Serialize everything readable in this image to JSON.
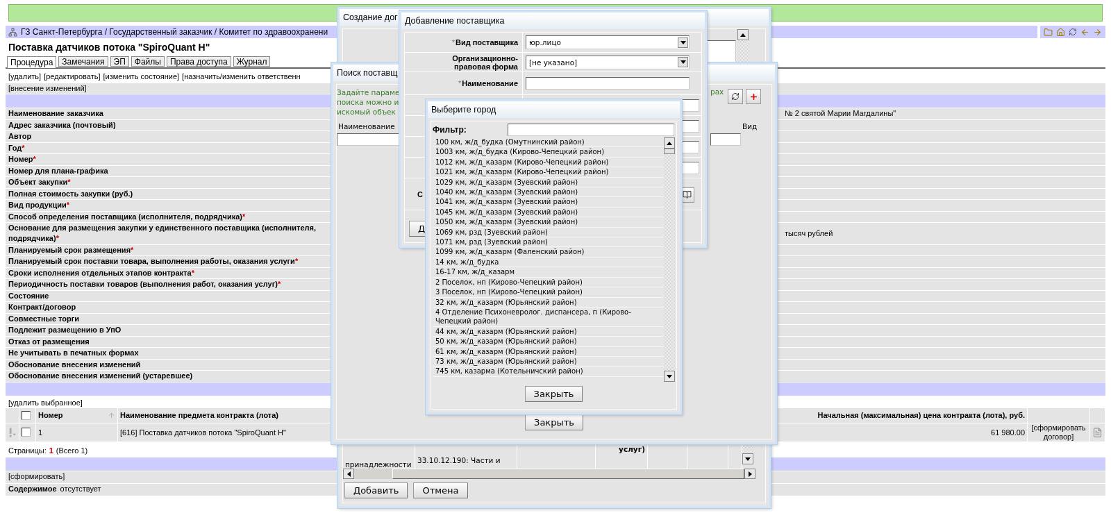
{
  "breadcrumb": "ГЗ Санкт-Петербурга / Государственный заказчик / Комитет по здравоохранени",
  "title": "Поставка датчиков потока \"SpiroQuant H\"",
  "tabs": [
    {
      "label": "Процедура",
      "selected": true
    },
    {
      "label": "Замечания",
      "selected": false
    },
    {
      "label": "ЭП",
      "selected": false
    },
    {
      "label": "Файлы",
      "selected": false
    },
    {
      "label": "Права доступа",
      "selected": false
    },
    {
      "label": "Журнал",
      "selected": false
    }
  ],
  "actions": [
    "[удалить]",
    "[редактировать]",
    "[изменить состояние]",
    "[назначить/изменить ответственн"
  ],
  "changes_link": "[внесение изменений]",
  "fields": [
    {
      "label": "Наименование заказчика",
      "value": "№ 2 святой Марии Магдалины\""
    },
    {
      "label": "Адрес заказчика (почтовый)"
    },
    {
      "label": "Автор"
    },
    {
      "label": "Год",
      "mark": "*"
    },
    {
      "label": "Номер",
      "mark": "*"
    },
    {
      "label": "Номер для плана-графика"
    },
    {
      "label": "Объект закупки",
      "mark": "*"
    },
    {
      "label": "Полная стоимость закупки (руб.)"
    },
    {
      "label": "Вид продукции",
      "mark": "*"
    },
    {
      "label": "Способ определения поставщика (исполнителя, подрядчика)",
      "mark": "*"
    },
    {
      "label": "Основание для размещения закупки у единственного поставщика (исполнителя, подрядчика)",
      "mark": "*",
      "value": "тысяч рублей"
    },
    {
      "label": "Планируемый срок размещения",
      "mark": "*"
    },
    {
      "label": "Планируемый срок поставки товара, выполнения работы, оказания услуги",
      "mark": "*"
    },
    {
      "label": "Сроки исполнения отдельных этапов контракта",
      "mark": "*"
    },
    {
      "label": "Периодичность поставки товаров (выполнения работ, оказания услуг)",
      "mark": "*"
    },
    {
      "label": "Состояние"
    },
    {
      "label": "Контракт/договор"
    },
    {
      "label": "Совместные торги"
    },
    {
      "label": "Подлежит размещению в УпО"
    },
    {
      "label": "Отказ от размещения"
    },
    {
      "label": "Не учитывать в печатных формах"
    },
    {
      "label": "Обоснование внесения изменений"
    },
    {
      "label": "Обоснование внесения изменений (устаревшее)"
    }
  ],
  "lots": {
    "delete_link": "[удалить выбранное]",
    "all_checked": false,
    "columns": [
      "Номер",
      "Наименование предмета контракта (лота)",
      "Начальная (максимальная) цена контракта (лота), руб."
    ],
    "rows": [
      {
        "checked": false,
        "number": "1",
        "name": "[616] Поставка датчиков потока \"SpiroQuant H\"",
        "price": "61 980.00",
        "action": "[сформировать договор]"
      }
    ]
  },
  "pager": {
    "label": "Страницы:",
    "current": "1",
    "total": "(Всего 1)"
  },
  "documents": {
    "action": "[сформировать]",
    "label": "Содержимое",
    "value": "отсутствует"
  },
  "create_dialog": {
    "title": "Создание дог",
    "header_fragment": "услуг)",
    "cells": [
      "принадлежности",
      "33.10.12.190: Части и"
    ],
    "buttons": [
      "Добавить",
      "Отмена"
    ]
  },
  "search_dialog": {
    "title": "Поиск поставщ",
    "hint_lines": [
      "Задайте параме",
      "поиска можно и",
      "искомый объек"
    ],
    "hint_tail": "рах",
    "columns": [
      "Наименование",
      "Вид"
    ],
    "close_button": "Закрыть"
  },
  "supplier_dialog": {
    "title": "Добавление поставщика",
    "fields": [
      {
        "kind": "select",
        "label": "Вид поставщика",
        "mark": "*",
        "value": "юр.лицо"
      },
      {
        "kind": "select",
        "label": "Организационно-правовая форма",
        "value": "[не указано]"
      },
      {
        "kind": "input",
        "label": "Наименование",
        "mark": "*"
      },
      {
        "kind": "input"
      },
      {
        "kind": "input"
      },
      {
        "kind": "input"
      },
      {
        "kind": "input"
      },
      {
        "kind": "book",
        "label": "С"
      }
    ],
    "button": "Д"
  },
  "city_dialog": {
    "title": "Выберите город",
    "filter_label": "Фильтр:",
    "cities": [
      "100 км, ж/д_будка (Омутнинский район)",
      "1003 км, ж/д_будка (Кирово-Чепецкий район)",
      "1012 км, ж/д_казарм (Кирово-Чепецкий район)",
      "1021 км, ж/д_казарм (Кирово-Чепецкий район)",
      "1029 км, ж/д_казарм (Зуевский район)",
      "1040 км, ж/д_казарм (Зуевский район)",
      "1041 км, ж/д_казарм (Зуевский район)",
      "1045 км, ж/д_казарм (Зуевский район)",
      "1050 км, ж/д_казарм (Зуевский район)",
      "1069 км, рзд (Зуевский район)",
      "1071 км, рзд (Зуевский район)",
      "1099 км, ж/д_казарм (Фаленский район)",
      "14 км, ж/д_будка",
      "16-17 км, ж/д_казарм",
      "2 Поселок, нп (Кирово-Чепецкий район)",
      "3 Поселок, нп (Кирово-Чепецкий район)",
      "32 км, ж/д_казарм (Юрьянский район)",
      "4 Отделение Психоневролог. диспансера, п (Кирово-Чепецкий район)",
      "44 км, ж/д_казарм (Юрьянский район)",
      "50 км, ж/д_казарм (Юрьянский район)",
      "61 км, ж/д_казарм (Юрьянский район)",
      "73 км, ж/д_казарм (Юрьянский район)",
      "745 км, казарма (Котельничский район)"
    ],
    "close_button": "Закрыть"
  }
}
